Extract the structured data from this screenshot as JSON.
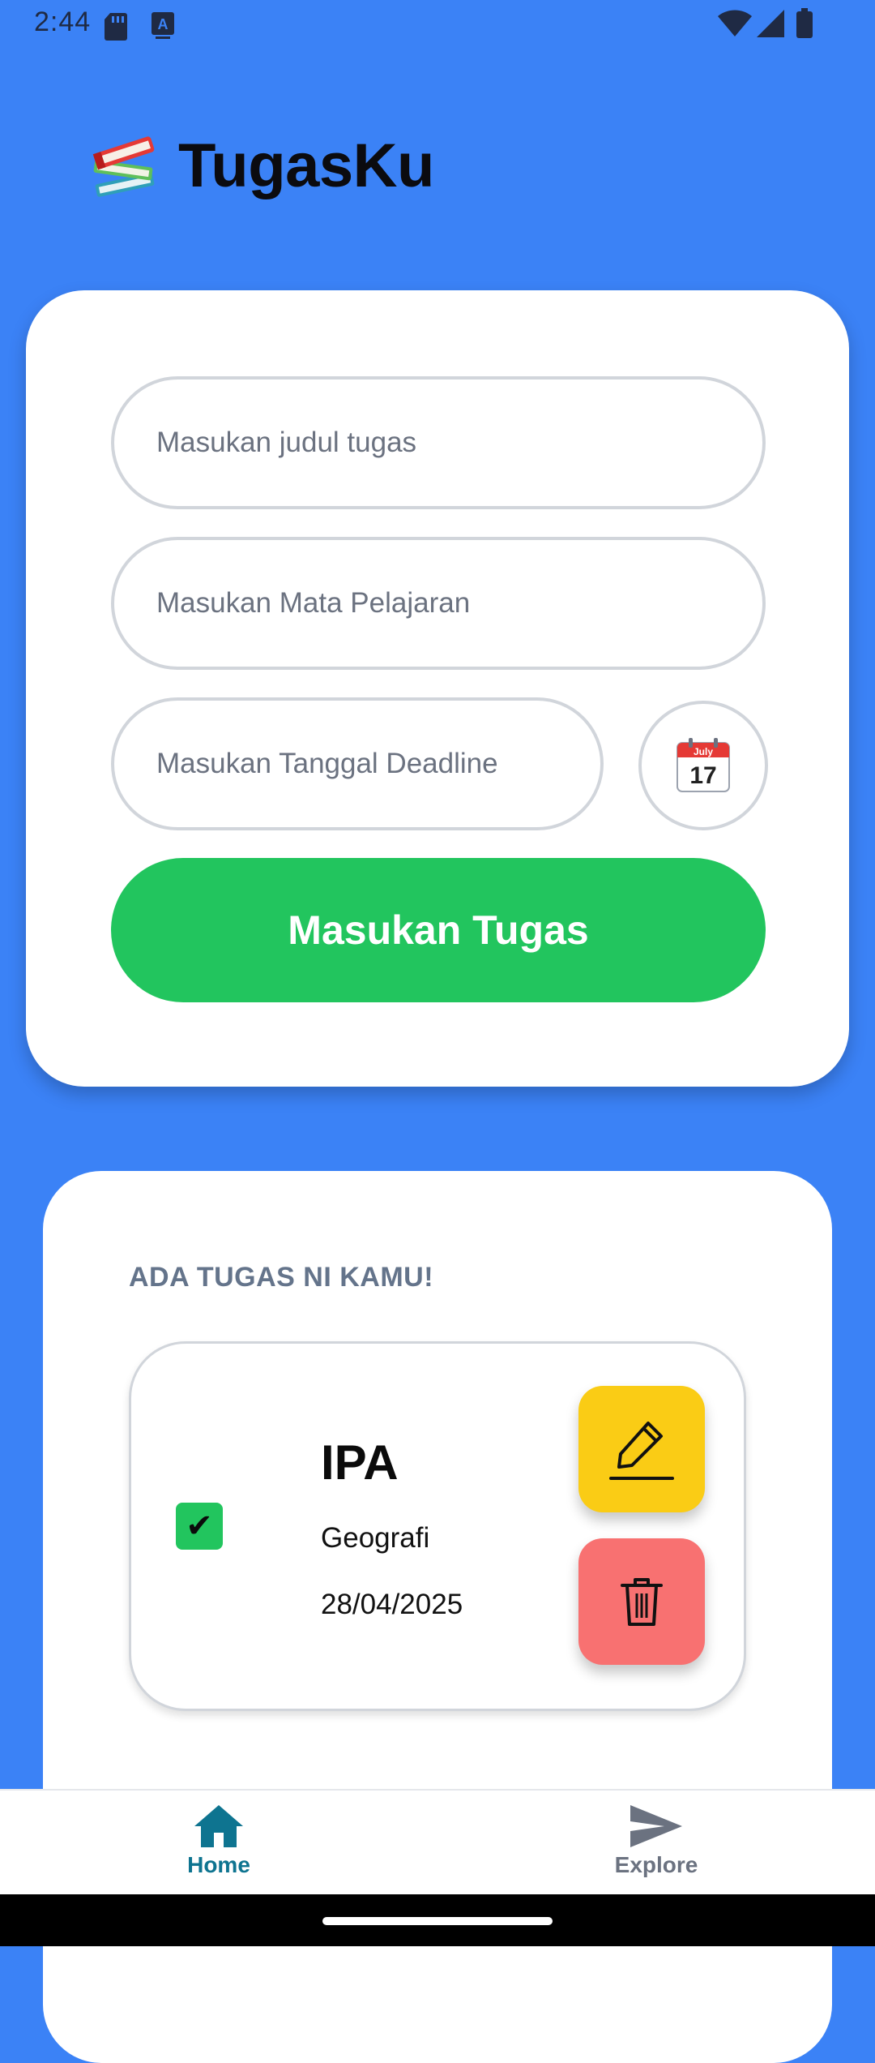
{
  "status_bar": {
    "time": "2:44"
  },
  "app": {
    "title": "TugasKu",
    "logo_icon": "books-emoji-icon"
  },
  "form": {
    "title_placeholder": "Masukan judul tugas",
    "subject_placeholder": "Masukan Mata Pelajaran",
    "deadline_placeholder": "Masukan Tanggal Deadline",
    "calendar_icon": {
      "month": "July",
      "day": "17"
    },
    "submit_label": "Masukan Tugas"
  },
  "task_list": {
    "heading": "ADA TUGAS NI KAMU!",
    "items": [
      {
        "checked": true,
        "check_glyph": "✔",
        "title": "IPA",
        "subject": "Geografi",
        "deadline": "28/04/2025"
      }
    ]
  },
  "bottom_nav": {
    "items": [
      {
        "label": "Home",
        "icon": "home-icon",
        "active": true
      },
      {
        "label": "Explore",
        "icon": "send-icon",
        "active": false
      }
    ]
  },
  "colors": {
    "background": "#3b82f6",
    "primary_button": "#22c55e",
    "edit_button": "#facc15",
    "delete_button": "#f87171",
    "nav_active": "#0e7490",
    "nav_inactive": "#6b7280"
  }
}
